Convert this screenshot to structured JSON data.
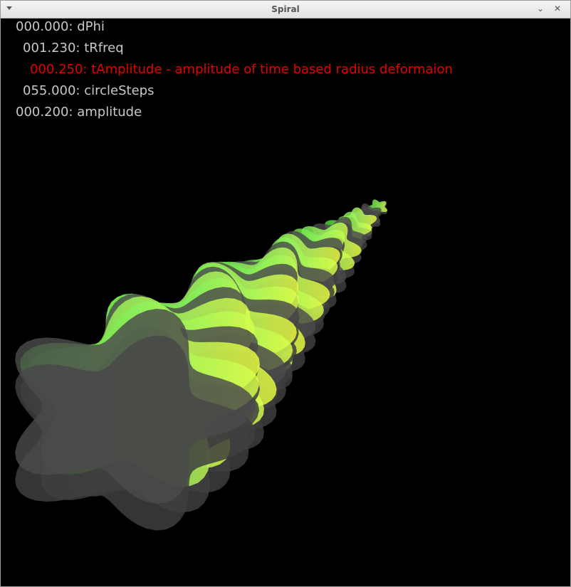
{
  "window": {
    "title": "Spiral",
    "minimize_glyph": "⌄",
    "close_glyph": "✕"
  },
  "params": [
    {
      "text": "000.000: dPhi",
      "selected": false
    },
    {
      "text": "001.230: tRfreq",
      "selected": false
    },
    {
      "text": "000.250: tAmplitude - amplitude of time based radius deformaion",
      "selected": true
    },
    {
      "text": "055.000: circleSteps",
      "selected": false
    },
    {
      "text": "000.200: amplitude",
      "selected": false
    }
  ],
  "colors": {
    "background": "#000000",
    "param_text": "#c8c8c8",
    "selected_param": "#e60000",
    "mesh_green": "#66e04a",
    "mesh_yellow": "#d8ff4a",
    "mesh_shadow": "#4a4a4a"
  }
}
